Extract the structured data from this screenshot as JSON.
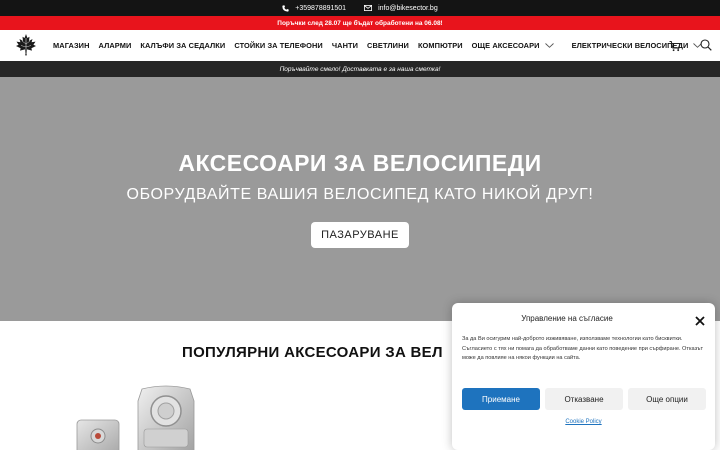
{
  "topbar": {
    "phone": "+359878891501",
    "email": "info@bikesector.bg",
    "phone_icon": "phone-icon",
    "email_icon": "envelope-icon"
  },
  "notice": {
    "text": "Поръчки след 28.07 ще бъдат обработени на 06.08!",
    "color": "#e8141c"
  },
  "nav": {
    "logo_icon": "maple-leaf-logo",
    "items": [
      {
        "label": "МАГАЗИН",
        "has_dropdown": false
      },
      {
        "label": "АЛАРМИ",
        "has_dropdown": false
      },
      {
        "label": "КАЛЪФИ ЗА СЕДАЛКИ",
        "has_dropdown": false
      },
      {
        "label": "СТОЙКИ ЗА ТЕЛЕФОНИ",
        "has_dropdown": false
      },
      {
        "label": "ЧАНТИ",
        "has_dropdown": false
      },
      {
        "label": "СВЕТЛИНИ",
        "has_dropdown": false
      },
      {
        "label": "КОМПЮТРИ",
        "has_dropdown": false
      },
      {
        "label": "ОЩЕ АКСЕСОАРИ",
        "has_dropdown": true
      },
      {
        "label": "ЕЛЕКТРИЧЕСКИ ВЕЛОСИПЕДИ",
        "has_dropdown": true
      }
    ],
    "cart_icon": "cart-icon",
    "search_icon": "search-icon"
  },
  "shipbar": {
    "text": "Поръчвайте смело! Доставката е за наша сметка!"
  },
  "hero": {
    "title": "АКСЕСОАРИ ЗА ВЕЛОСИПЕДИ",
    "subtitle": "ОБОРУДВАЙТЕ ВАШИЯ ВЕЛОСИПЕД КАТО НИКОЙ ДРУГ!",
    "button": "ПАЗАРУВАНЕ",
    "background": "#9a9a9a"
  },
  "section": {
    "title": "ПОПУЛЯРНИ АКСЕСОАРИ ЗА ВЕЛ"
  },
  "consent": {
    "title": "Управление на съгласие",
    "text": "За да Ви осигурим най-доброто изживяване, използваме технологии като бисквитки. Съгласието с тях ни помага да обработваме данни като поведение при сърфиране. Отказът може да повлияе на някои функции на сайта.",
    "accept": "Приемане",
    "deny": "Отказване",
    "options": "Още опции",
    "policy_link": "Cookie Policy",
    "accent": "#1e73be"
  }
}
